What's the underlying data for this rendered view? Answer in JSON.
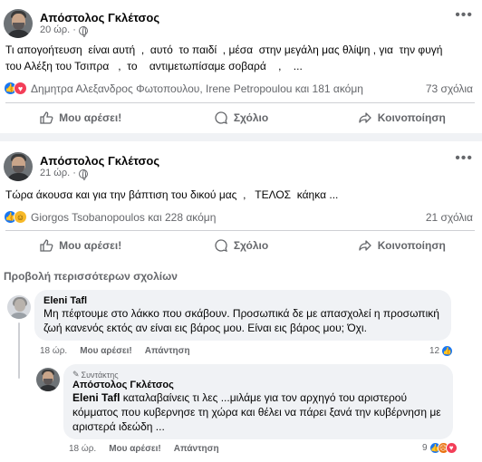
{
  "posts": [
    {
      "author": "Απόστολος Γκλέτσος",
      "time": "20 ώρ. ·",
      "text": "Τι απογοήτευση  είναι αυτή  ,  αυτό  το παιδί  , μέσα  στην μεγάλη μας θλίψη , για  την φυγή\nτου Αλέξη του Τσιπρα   ,  το    αντιμετωπίσαμε σοβαρά    ,    ...",
      "reactors": "Δημητρα Αλεξανδρος Φωτοπουλου, Irene Petropoulou και 181 ακόμη",
      "comments": "73 σχόλια"
    },
    {
      "author": "Απόστολος Γκλέτσος",
      "time": "21 ώρ. ·",
      "text": "Τώρα άκουσα και για την βάπτιση του δικού μας  ,   ΤΕΛΟΣ  κάηκα ...",
      "reactors": "Giorgos Tsobanopoulos και 228 ακόμη",
      "comments": "21 σχόλια"
    }
  ],
  "actions": {
    "like": "Μου αρέσει!",
    "comment": "Σχόλιο",
    "share": "Κοινοποίηση"
  },
  "more_comments": "Προβολή περισσότερων σχολίων",
  "comment1": {
    "name": "Eleni Tafl",
    "text": "Μη πέφτουμε στο λάκκο που σκάβουν. Προσωπικά δε με απασχολεί η προσωπική ζωή κανενός εκτός αν είναι εις βάρος μου. Είναι εις βάρος μου; Όχι.",
    "time": "18 ώρ.",
    "like": "Μου αρέσει!",
    "reply": "Απάντηση",
    "reaction_count": "12"
  },
  "comment2": {
    "badge": "Συντάκτης",
    "name": "Απόστολος Γκλέτσος",
    "mention": "Eleni Tafl",
    "text": " καταλαβαίνεις τι λες ...μιλάμε για τον αρχηγό του αριστερού κόμματος που κυβερνησε τη χώρα και θέλει να πάρει ξανά την κυβέρνηση με αριστερά ιδεώδη ...",
    "time": "18 ώρ.",
    "like": "Μου αρέσει!",
    "reply": "Απάντηση",
    "reaction_count": "9"
  },
  "colors": {
    "like": "#1877f2",
    "love": "#f33e58",
    "haha": "#f7b928",
    "angry": "#e9710f"
  }
}
